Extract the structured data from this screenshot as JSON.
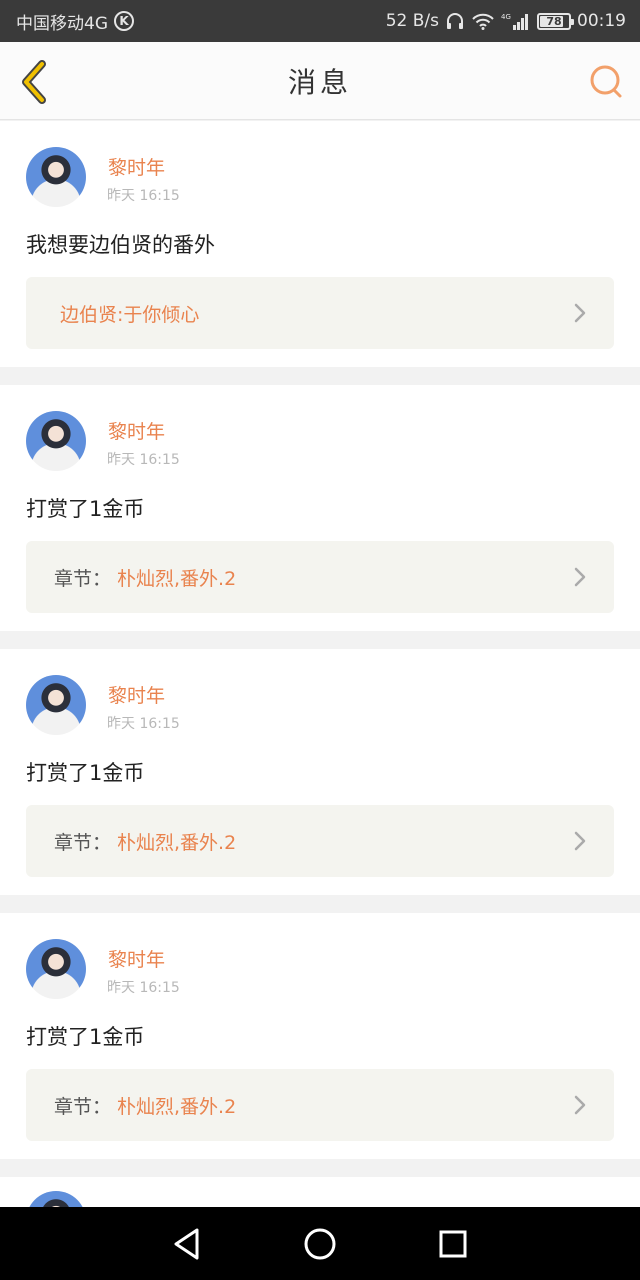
{
  "statusbar": {
    "carrier": "中国移动4G",
    "carrier_badge": "K",
    "speed": "52 B/s",
    "network": "4G",
    "battery": "78",
    "time": "00:19"
  },
  "header": {
    "title": "消息"
  },
  "messages": [
    {
      "name": "黎时年",
      "time": "昨天 16:15",
      "content": "我想要边伯贤的番外",
      "link_label": "",
      "link_value": "边伯贤:于你倾心"
    },
    {
      "name": "黎时年",
      "time": "昨天 16:15",
      "content": "打赏了1金币",
      "link_label": "章节：",
      "link_value": "朴灿烈,番外.2"
    },
    {
      "name": "黎时年",
      "time": "昨天 16:15",
      "content": "打赏了1金币",
      "link_label": "章节：",
      "link_value": "朴灿烈,番外.2"
    },
    {
      "name": "黎时年",
      "time": "昨天 16:15",
      "content": "打赏了1金币",
      "link_label": "章节：",
      "link_value": "朴灿烈,番外.2"
    }
  ],
  "colors": {
    "accent": "#e9834e",
    "back_arrow": "#f0c000",
    "statusbar_bg": "#3a3a3a"
  },
  "icons": {
    "back": "chevron-left-icon",
    "search": "search-icon",
    "arrow": "chevron-right-icon",
    "nav_back": "triangle-back-icon",
    "nav_home": "circle-home-icon",
    "nav_recent": "square-recent-icon"
  }
}
